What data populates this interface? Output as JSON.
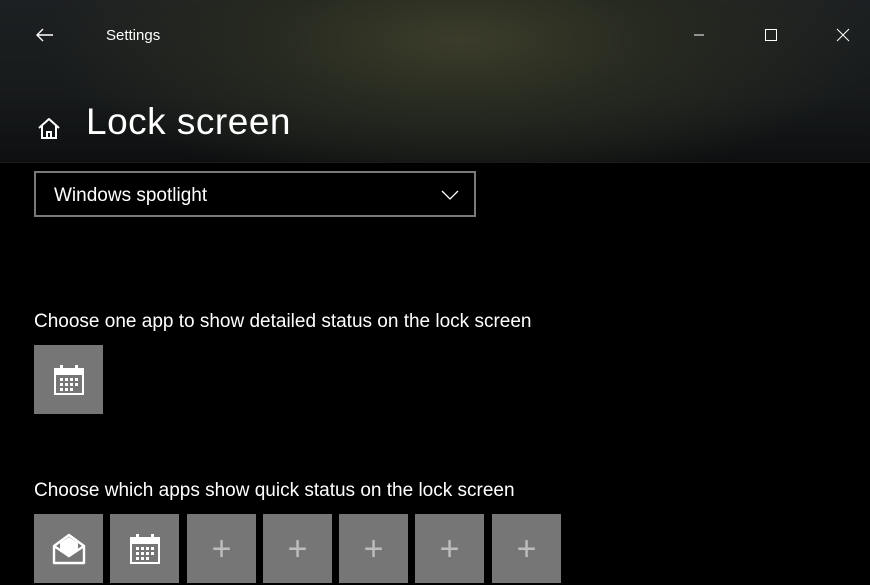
{
  "window": {
    "app_title": "Settings",
    "minimize_icon": "minimize-icon",
    "maximize_icon": "maximize-icon",
    "close_icon": "close-icon"
  },
  "page": {
    "title": "Lock screen",
    "home_icon": "home-icon"
  },
  "background_dropdown": {
    "selected": "Windows spotlight"
  },
  "detailed_status": {
    "label": "Choose one app to show detailed status on the lock screen",
    "app_icon": "calendar-icon"
  },
  "quick_status": {
    "label": "Choose which apps show quick status on the lock screen",
    "slots": [
      {
        "icon": "mail-icon"
      },
      {
        "icon": "calendar-icon"
      },
      {
        "icon": "plus-icon",
        "text": "+"
      },
      {
        "icon": "plus-icon",
        "text": "+"
      },
      {
        "icon": "plus-icon",
        "text": "+"
      },
      {
        "icon": "plus-icon",
        "text": "+"
      },
      {
        "icon": "plus-icon",
        "text": "+"
      }
    ]
  }
}
